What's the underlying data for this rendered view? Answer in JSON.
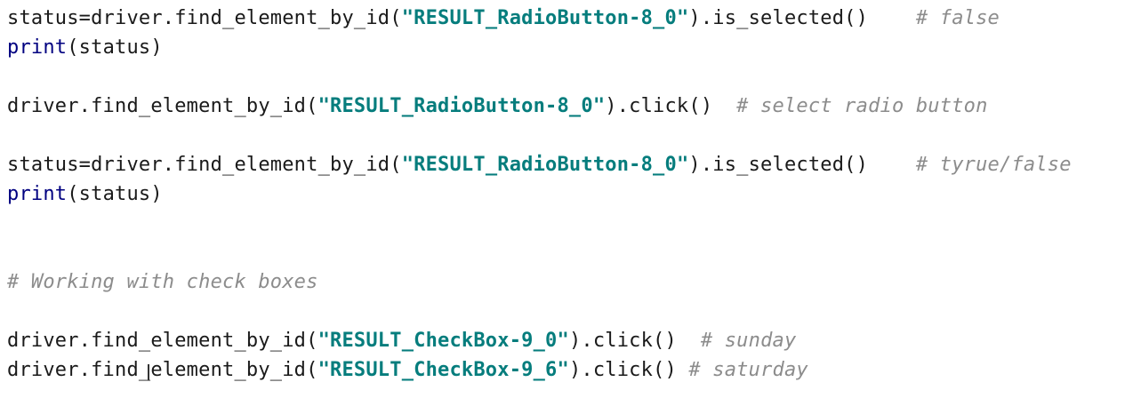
{
  "editor": {
    "lines": [
      {
        "code1": "status=driver.find_element_by_id(",
        "str": "\"RESULT_RadioButton-8_0\"",
        "code2": ").is_selected()",
        "pad": "    ",
        "comment": "# false"
      },
      {
        "fn": "print",
        "code": "(status)"
      },
      {
        "code1": "driver.find_element_by_id(",
        "str": "\"RESULT_RadioButton-8_0\"",
        "code2": ").click()",
        "pad": "  ",
        "comment": "# select radio button"
      },
      {
        "code1": "status=driver.find_element_by_id(",
        "str": "\"RESULT_RadioButton-8_0\"",
        "code2": ").is_selected()",
        "pad": "    ",
        "comment": "# tyrue/false"
      },
      {
        "fn": "print",
        "code": "(status)"
      },
      {
        "comment": "# Working with check boxes"
      },
      {
        "code1": "driver.find_element_by_id(",
        "str": "\"RESULT_CheckBox-9_0\"",
        "code2": ").click()",
        "pad": "  ",
        "comment": "# sunday"
      },
      {
        "code1": "driver.find_element_by_id(",
        "str": "\"RESULT_CheckBox-9_6\"",
        "code2": ").click()",
        "pad": " ",
        "comment": "# saturday"
      }
    ]
  }
}
